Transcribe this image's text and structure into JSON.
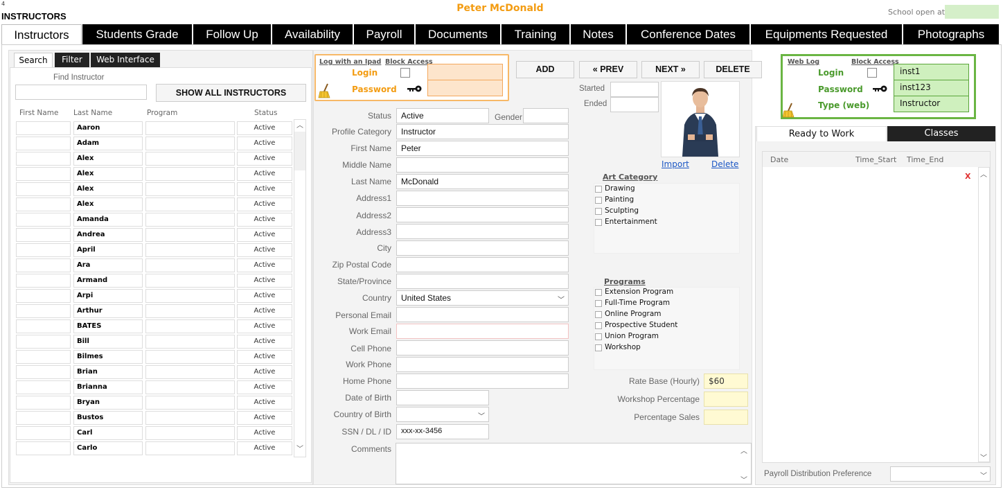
{
  "corner_number": "4",
  "app_title": "INSTRUCTORS",
  "person_name": "Peter McDonald",
  "school_open_label": "School open at",
  "tabs": [
    {
      "label": "Instructors",
      "active": true
    },
    {
      "label": "Students Grade"
    },
    {
      "label": "Follow Up"
    },
    {
      "label": "Availability"
    },
    {
      "label": "Payroll"
    },
    {
      "label": "Documents"
    },
    {
      "label": "Training"
    },
    {
      "label": "Notes"
    },
    {
      "label": "Conference Dates"
    },
    {
      "label": "Equipments Requested"
    },
    {
      "label": "Photographs"
    }
  ],
  "left": {
    "subtabs": [
      "Search",
      "Filter",
      "Web Interface"
    ],
    "find_label": "Find Instructor",
    "show_all_label": "SHOW ALL INSTRUCTORS",
    "columns": [
      "First Name",
      "Last Name",
      "Program",
      "Status"
    ],
    "rows": [
      {
        "last": "Aaron",
        "status": "Active"
      },
      {
        "last": "Adam",
        "status": "Active"
      },
      {
        "last": "Alex",
        "status": "Active"
      },
      {
        "last": "Alex",
        "status": "Active"
      },
      {
        "last": "Alex",
        "status": "Active"
      },
      {
        "last": "Alex",
        "status": "Active"
      },
      {
        "last": "Amanda",
        "status": "Active"
      },
      {
        "last": "Andrea",
        "status": "Active"
      },
      {
        "last": "April",
        "status": "Active"
      },
      {
        "last": "Ara",
        "status": "Active"
      },
      {
        "last": "Armand",
        "status": "Active"
      },
      {
        "last": "Arpi",
        "status": "Active"
      },
      {
        "last": "Arthur",
        "status": "Active"
      },
      {
        "last": "BATES",
        "status": "Active"
      },
      {
        "last": "Bill",
        "status": "Active"
      },
      {
        "last": "Bilmes",
        "status": "Active"
      },
      {
        "last": "Brian",
        "status": "Active"
      },
      {
        "last": "Brianna",
        "status": "Active"
      },
      {
        "last": "Bryan",
        "status": "Active"
      },
      {
        "last": "Bustos",
        "status": "Active"
      },
      {
        "last": "Carl",
        "status": "Active"
      },
      {
        "last": "Carlo",
        "status": "Active"
      }
    ]
  },
  "ipad": {
    "log_label": "Log with an Ipad",
    "block_label": "Block Access",
    "login_label": "Login",
    "password_label": "Password"
  },
  "nav": {
    "add": "ADD",
    "prev": "« PREV",
    "next": "NEXT »",
    "delete": "DELETE"
  },
  "dates": {
    "started_label": "Started",
    "ended_label": "Ended"
  },
  "photo": {
    "import_label": "Import",
    "delete_label": "Delete"
  },
  "web": {
    "web_log_label": "Web Log",
    "block_label": "Block Access",
    "login_label": "Login",
    "password_label": "Password",
    "type_label": "Type (web)",
    "login_value": "inst1",
    "password_value": "inst123",
    "type_value": "Instructor"
  },
  "form": {
    "status_label": "Status",
    "status_value": "Active",
    "gender_label": "Gender",
    "profile_label": "Profile Category",
    "profile_value": "Instructor",
    "first_label": "First Name",
    "first_value": "Peter",
    "middle_label": "Middle Name",
    "last_label": "Last Name",
    "last_value": "McDonald",
    "address1_label": "Address1",
    "address2_label": "Address2",
    "address3_label": "Address3",
    "city_label": "City",
    "zip_label": "Zip Postal Code",
    "state_label": "State/Province",
    "country_label": "Country",
    "country_value": "United States",
    "pemail_label": "Personal Email",
    "wemail_label": "Work Email",
    "cell_label": "Cell Phone",
    "wphone_label": "Work Phone",
    "hphone_label": "Home Phone",
    "dob_label": "Date of Birth",
    "cob_label": "Country of Birth",
    "ssn_label": "SSN / DL / ID",
    "ssn_value": "xxx-xx-3456",
    "comments_label": "Comments"
  },
  "art": {
    "title": "Art Category",
    "items": [
      "Drawing",
      "Painting",
      "Sculpting",
      "Entertainment"
    ]
  },
  "programs": {
    "title": "Programs",
    "items": [
      "Extension Program",
      "Full-Time Program",
      "Online Program",
      "Prospective Student",
      "Union Program",
      "Workshop"
    ]
  },
  "rates": {
    "rate_label": "Rate Base (Hourly)",
    "rate_value": "$60",
    "workshop_label": "Workshop Percentage",
    "sales_label": "Percentage Sales"
  },
  "right": {
    "tabs": [
      "Ready to Work",
      "Classes"
    ],
    "columns": [
      "Date",
      "Time_Start",
      "Time_End"
    ],
    "remove_mark": "X",
    "payroll_label": "Payroll Distribution Preference"
  },
  "colors": {
    "accent_orange": "#F39C12",
    "accent_green": "#6AB543",
    "tab_dark": "#000000"
  }
}
